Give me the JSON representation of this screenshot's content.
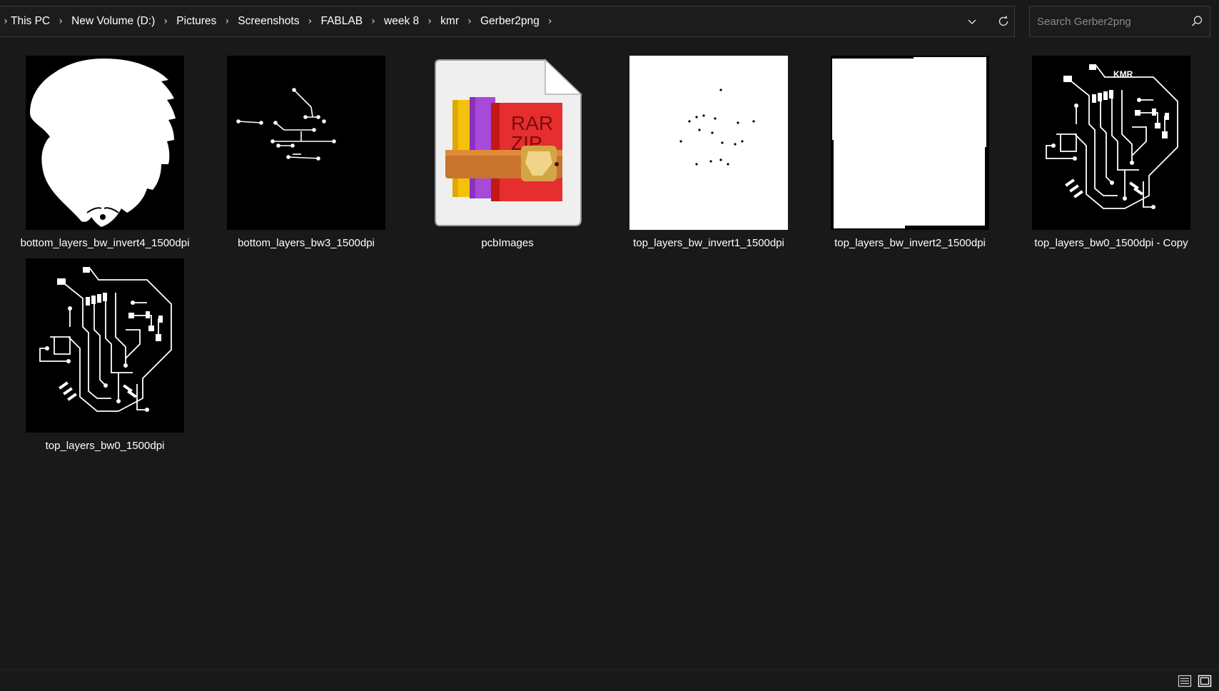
{
  "address_bar": {
    "crumbs": [
      "This PC",
      "New Volume (D:)",
      "Pictures",
      "Screenshots",
      "FABLAB",
      "week 8",
      "kmr",
      "Gerber2png"
    ],
    "dropdown_icon": "chevron-down-icon",
    "refresh_icon": "refresh-icon"
  },
  "search": {
    "placeholder": "Search Gerber2png",
    "value": "",
    "icon": "search-icon"
  },
  "files": [
    {
      "name": "bottom_layers_bw_invert4_1500dpi",
      "kind": "eagle-image"
    },
    {
      "name": "bottom_layers_bw3_1500dpi",
      "kind": "traces-image"
    },
    {
      "name": "pcbImages",
      "kind": "rar-archive"
    },
    {
      "name": "top_layers_bw_invert1_1500dpi",
      "kind": "dots-image"
    },
    {
      "name": "top_layers_bw_invert2_1500dpi",
      "kind": "white-board-image"
    },
    {
      "name": "top_layers_bw0_1500dpi - Copy",
      "kind": "pcb-image",
      "thumb_text": "KMR"
    },
    {
      "name": "top_layers_bw0_1500dpi",
      "kind": "pcb-image"
    }
  ],
  "status_bar": {
    "details_view_icon": "details-view-icon",
    "large_icons_view_icon": "large-icons-view-icon"
  },
  "colors": {
    "background": "#191919",
    "border": "#3a3a3a",
    "text": "#ffffff",
    "placeholder": "#8a8a8a"
  }
}
